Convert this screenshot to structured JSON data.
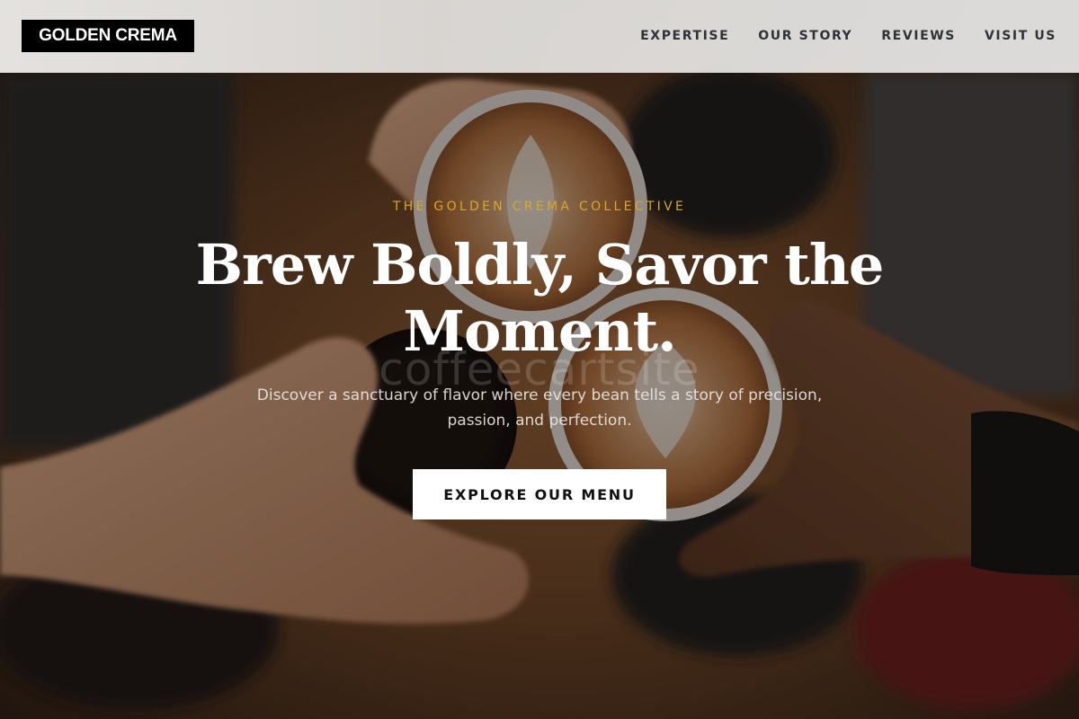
{
  "brand": {
    "logo_text": "GOLDEN CREMA"
  },
  "nav": {
    "links": [
      {
        "label": "EXPERTISE"
      },
      {
        "label": "OUR STORY"
      },
      {
        "label": "REVIEWS"
      },
      {
        "label": "VISIT US"
      }
    ]
  },
  "hero": {
    "eyebrow": "THE GOLDEN CREMA COLLECTIVE",
    "headline": "Brew Boldly, Savor the Moment.",
    "watermark": "coffeecartsite",
    "subtitle": "Discover a sanctuary of flavor where every bean tells a story of precision, passion, and perfection.",
    "cta_label": "EXPLORE OUR MENU",
    "background_image": "coffee-cups-toast-photo"
  },
  "colors": {
    "accent": "#d8a52e",
    "nav_text": "#2f3237",
    "logo_bg": "#000000",
    "cta_bg": "#ffffff"
  }
}
